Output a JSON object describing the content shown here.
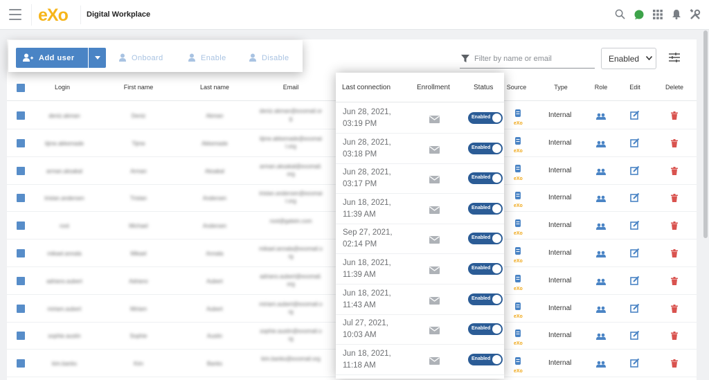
{
  "app": {
    "logo_text": "eXo",
    "title": "Digital Workplace"
  },
  "top_icons": [
    "search-icon",
    "chat-icon",
    "apps-grid-icon",
    "bell-icon",
    "admin-tools-icon"
  ],
  "toolbar": {
    "add_user_label": "Add user",
    "onboard_label": "Onboard",
    "enable_label": "Enable",
    "disable_label": "Disable"
  },
  "filter": {
    "placeholder": "Filter by name or email"
  },
  "status_select": {
    "selected": "Enabled"
  },
  "columns": {
    "login": "Login",
    "first_name": "First name",
    "last_name": "Last name",
    "email": "Email",
    "last_connection": "Last connection",
    "enrollment": "Enrollment",
    "status": "Status",
    "source": "Source",
    "type": "Type",
    "role": "Role",
    "edit": "Edit",
    "delete": "Delete"
  },
  "users": [
    {
      "login": "deniz.akman",
      "first_name": "Deniz",
      "last_name": "Akman",
      "email": "deniz.akman@exomail.org",
      "last_connection": [
        "Jun 28, 2021,",
        "03:19 PM"
      ],
      "status": "Enabled",
      "source": "eXo",
      "type": "Internal"
    },
    {
      "login": "tijme.akkemade",
      "first_name": "Tijme",
      "last_name": "Akkemade",
      "email": "tijme.akkemade@exomail.org",
      "last_connection": [
        "Jun 28, 2021,",
        "03:18 PM"
      ],
      "status": "Enabled",
      "source": "eXo",
      "type": "Internal"
    },
    {
      "login": "arman.aksakal",
      "first_name": "Arman",
      "last_name": "Aksakal",
      "email": "arman.aksakal@exomail.org",
      "last_connection": [
        "Jun 28, 2021,",
        "03:17 PM"
      ],
      "status": "Enabled",
      "source": "eXo",
      "type": "Internal"
    },
    {
      "login": "tristan.andersen",
      "first_name": "Tristan",
      "last_name": "Andersen",
      "email": "tristan.andersen@exomail.org",
      "last_connection": [
        "Jun 18, 2021,",
        "11:39 AM"
      ],
      "status": "Enabled",
      "source": "eXo",
      "type": "Internal"
    },
    {
      "login": "root",
      "first_name": "Michael",
      "last_name": "Andersen",
      "email": "root@gatein.com",
      "last_connection": [
        "Sep 27, 2021,",
        "02:14 PM"
      ],
      "status": "Enabled",
      "source": "eXo",
      "type": "Internal"
    },
    {
      "login": "mikael.annala",
      "first_name": "Mikael",
      "last_name": "Annala",
      "email": "mikael.annala@exomail.org",
      "last_connection": [
        "Jun 18, 2021,",
        "11:39 AM"
      ],
      "status": "Enabled",
      "source": "eXo",
      "type": "Internal"
    },
    {
      "login": "adriano.aubert",
      "first_name": "Adriano",
      "last_name": "Aubert",
      "email": "adriano.aubert@exomail.org",
      "last_connection": [
        "Jun 18, 2021,",
        "11:43 AM"
      ],
      "status": "Enabled",
      "source": "eXo",
      "type": "Internal"
    },
    {
      "login": "miriam.aubert",
      "first_name": "Miriam",
      "last_name": "Aubert",
      "email": "miriam.aubert@exomail.org",
      "last_connection": [
        "Jul 27, 2021,",
        "10:03 AM"
      ],
      "status": "Enabled",
      "source": "eXo",
      "type": "Internal"
    },
    {
      "login": "sophie.austin",
      "first_name": "Sophie",
      "last_name": "Austin",
      "email": "sophie.austin@exomail.org",
      "last_connection": [
        "Jun 18, 2021,",
        "11:18 AM"
      ],
      "status": "Enabled",
      "source": "eXo",
      "type": "Internal"
    },
    {
      "login": "kim.banks",
      "first_name": "Kim",
      "last_name": "Banks",
      "email": "kim.banks@exomail.org",
      "last_connection": [],
      "status": "Enabled",
      "source": "eXo",
      "type": "Internal"
    }
  ],
  "colors": {
    "primary": "#4a84c5",
    "toggle": "#2b5c96",
    "logo": "#f6b51b",
    "delete": "#d9534f"
  }
}
